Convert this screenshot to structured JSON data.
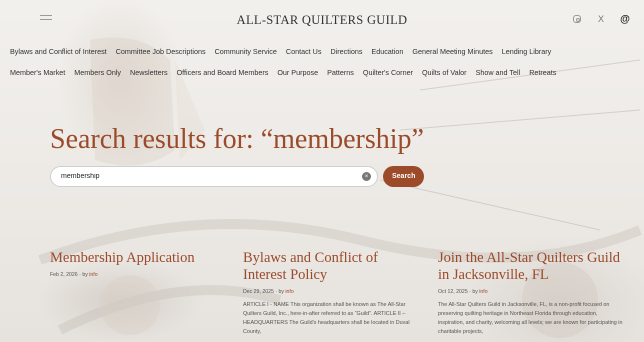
{
  "header": {
    "site_title": "ALL-STAR QUILTERS GUILD",
    "social_icons": [
      "instagram-icon",
      "x-icon",
      "threads-icon"
    ],
    "x_glyph": "X",
    "threads_glyph": "@"
  },
  "nav": {
    "row1": [
      "Bylaws and Conflict of Interest",
      "Committee Job Descriptions",
      "Community Service",
      "Contact Us",
      "Directions",
      "Education",
      "General Meeting Minutes",
      "Lending Library"
    ],
    "row2": [
      "Member's Market",
      "Members Only",
      "Newsletters",
      "Officers and Board Members",
      "Our Purpose",
      "Patterns",
      "Quilter's Corner",
      "Quilts of Valor",
      "Show and Tell",
      "Retreats"
    ]
  },
  "search": {
    "heading": "Search results for: “membership”",
    "query": "membership",
    "button_label": "Search",
    "clear_glyph": "×"
  },
  "results": [
    {
      "title": "Membership Application",
      "date": "Feb 2, 2026",
      "by": " · by ",
      "author": "info",
      "excerpt": ""
    },
    {
      "title": "Bylaws and Conflict of Interest Policy",
      "date": "Dec 29, 2025",
      "by": " · by ",
      "author": "info",
      "excerpt": "ARTICLE I - NAME This organization shall be known as The All-Star Quilters Guild, Inc., here-in-after referred to as “Guild”. ARTICLE II – HEADQUARTERS The Guild's headquarters shall be located in Duval County,"
    },
    {
      "title": "Join the All-Star Quilters Guild in Jacksonville, FL",
      "date": "Oct 12, 2025",
      "by": " · by ",
      "author": "info",
      "excerpt": "The All-Star Quilters Guild in Jacksonville, FL, is a non-profit focused on preserving quilting heritage in Northeast Florida through education, inspiration, and charity, welcoming all levels; we are known for participating in charitable projects,"
    }
  ],
  "colors": {
    "accent": "#9b4a2a",
    "background": "#f1efec"
  }
}
